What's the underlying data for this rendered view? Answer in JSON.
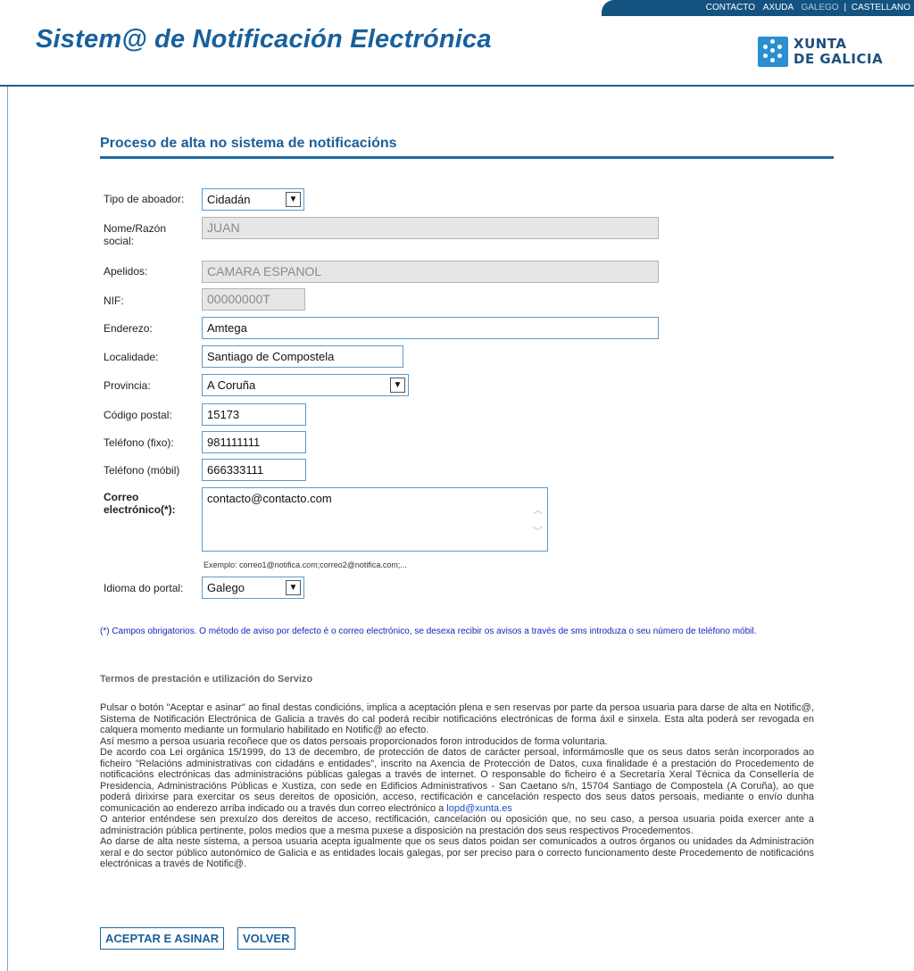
{
  "header": {
    "links": [
      "CONTACTO",
      "AXUDA"
    ],
    "languages": [
      "GALEGO",
      "CASTELLANO"
    ],
    "lang_separator": "|",
    "site_title": "Sistem@ de Notificación Electrónica",
    "logo_line1": "XUNTA",
    "logo_line2": "DE GALICIA"
  },
  "form": {
    "section_title": "Proceso de alta no sistema de notificacións",
    "tipo_label": "Tipo de aboador:",
    "tipo_value": "Cidadán",
    "nome_label": "Nome/Razón social:",
    "nome_value": "JUAN",
    "apelidos_label": "Apelidos:",
    "apelidos_value": "CAMARA ESPANOL",
    "nif_label": "NIF:",
    "nif_value": "00000000T",
    "enderezo_label": "Enderezo:",
    "enderezo_value": "Amtega",
    "localidade_label": "Localidade:",
    "localidade_value": "Santiago de Compostela",
    "provincia_label": "Provincia:",
    "provincia_value": "A Coruña",
    "cp_label": "Código postal:",
    "cp_value": "15173",
    "tel_fixo_label": "Teléfono (fixo):",
    "tel_fixo_value": "981111111",
    "tel_mobil_label": "Teléfono (móbil)",
    "tel_mobil_value": "666333111",
    "correo_label": "Correo electrónico(*):",
    "correo_value": "contacto@contacto.com",
    "correo_hint": "Exemplo: correo1@notifica.com;correo2@notifica.com;...",
    "idioma_label": "Idioma do portal:",
    "idioma_value": "Galego",
    "required_note": "(*) Campos obrigatorios. O método de aviso por defecto é o correo electrónico, se desexa recibir os avisos a través de sms introduza o seu número de teléfono móbil."
  },
  "terms": {
    "title": "Termos de prestación e utilización do Servizo",
    "p1": "Pulsar o botón \"Aceptar e asinar\" ao final destas condicións, implica a aceptación plena e sen reservas por parte da persoa usuaria para darse de alta en Notific@, Sistema de Notificación Electrónica de Galicia a través do cal poderá recibir notificacións electrónicas de forma áxil e sinxela. Esta alta poderá ser revogada en calquera momento mediante un formulario habilitado en Notific@ ao efecto.",
    "p2": "Así mesmo a persoa usuaria recoñece que os datos persoais proporcionados foron introducidos de forma voluntaria.",
    "p3": "De acordo coa Lei orgánica 15/1999, do 13 de decembro, de protección de datos de carácter persoal, informámoslle que os seus datos serán incorporados ao ficheiro \"Relacións administrativas con cidadáns e entidades\", inscrito na Axencia de Protección de Datos, cuxa finalidade é a prestación do Procedemento de notificacións electrónicas das administracións públicas galegas a través de internet. O responsable do ficheiro é a Secretaría Xeral Técnica da Consellería de Presidencia, Administracións Públicas e Xustiza, con sede en Edificios Administrativos - San Caetano s/n, 15704 Santiago de Compostela (A Coruña), ao que poderá dirixirse para exercitar os seus dereitos de oposición, acceso, rectificación e cancelación respecto dos seus datos persoais, mediante o envío dunha comunicación ao enderezo arriba indicado ou a través dun correo electrónico a",
    "email_link": "lopd@xunta.es",
    "p4": "O anterior enténdese sen prexuízo dos dereitos de acceso, rectificación, cancelación ou oposición que, no seu caso, a persoa usuaria poida exercer ante a administración pública pertinente, polos medios que a mesma puxese a disposición na prestación dos seus respectivos Procedementos.",
    "p5": "Ao darse de alta neste sistema, a persoa usuaria acepta igualmente que os seus datos poidan ser comunicados a outros órganos ou unidades da Administración xeral e do sector público autonómico de Galicia e as entidades locais galegas, por ser preciso para o correcto funcionamento deste Procedemento de notificacións electrónicas a través de Notific@."
  },
  "buttons": {
    "accept": "ACEPTAR E ASINAR",
    "back": "VOLVER"
  },
  "colors": {
    "brand_blue": "#17609c",
    "topbar": "#14527f",
    "note_text": "#1426b8"
  }
}
